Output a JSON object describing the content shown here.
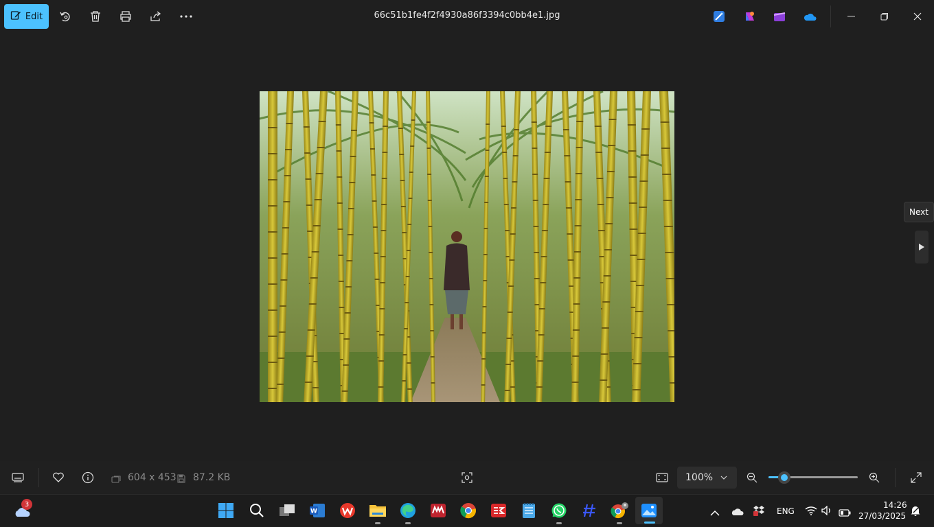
{
  "toolbar": {
    "edit_label": "Edit",
    "filename": "66c51b1fe4f2f4930a86f3394c0bb4e1.jpg"
  },
  "viewer": {
    "next_label": "Next"
  },
  "bottom": {
    "dimensions": "604 x 453",
    "file_size": "87.2 KB",
    "zoom_level": "100%",
    "zoom_slider_fraction": 0.18
  },
  "taskbar": {
    "weather_badge": "3",
    "language": "ENG",
    "time": "14:26",
    "date": "27/03/2025"
  },
  "colors": {
    "accent": "#4cc2ff",
    "background": "#1f1f1f"
  }
}
